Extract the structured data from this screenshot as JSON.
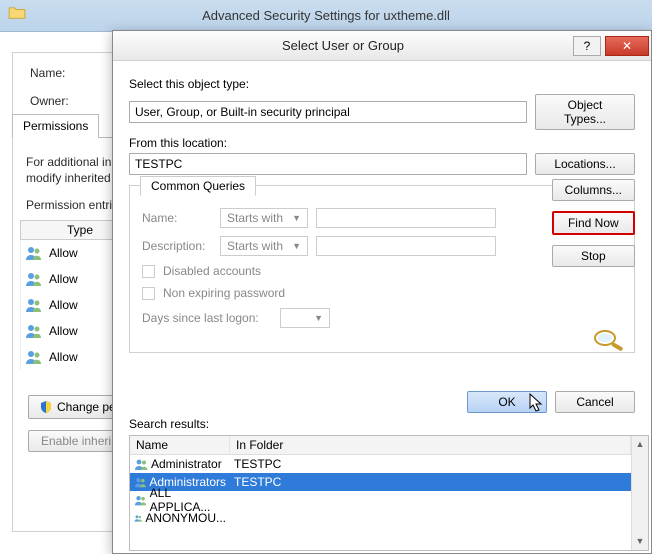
{
  "main_window": {
    "title": "Advanced Security Settings for uxtheme.dll",
    "name_label": "Name:",
    "owner_label": "Owner:",
    "tab_permissions": "Permissions",
    "info_line1": "For additional in",
    "info_line2": "modify inherited",
    "entries_label": "Permission entri",
    "type_header": "Type",
    "rows": [
      "Allow",
      "Allow",
      "Allow",
      "Allow",
      "Allow"
    ],
    "change_btn": "Change pe",
    "enable_btn": "Enable inheri"
  },
  "dialog": {
    "title": "Select User or Group",
    "object_type_label": "Select this object type:",
    "object_type_value": "User, Group, or Built-in security principal",
    "object_types_btn": "Object Types...",
    "location_label": "From this location:",
    "location_value": "TESTPC",
    "locations_btn": "Locations...",
    "common_queries_tab": "Common Queries",
    "name_label": "Name:",
    "desc_label": "Description:",
    "starts_with": "Starts with",
    "disabled_accounts": "Disabled accounts",
    "non_expiring": "Non expiring password",
    "days_since": "Days since last logon:",
    "columns_btn": "Columns...",
    "find_now_btn": "Find Now",
    "stop_btn": "Stop",
    "ok_btn": "OK",
    "cancel_btn": "Cancel",
    "search_results_label": "Search results:",
    "result_col_name": "Name",
    "result_col_folder": "In Folder",
    "results": [
      {
        "name": "Administrator",
        "folder": "TESTPC",
        "selected": false
      },
      {
        "name": "Administrators",
        "folder": "TESTPC",
        "selected": true
      },
      {
        "name": "ALL APPLICA...",
        "folder": "",
        "selected": false
      },
      {
        "name": "ANONYMOU...",
        "folder": "",
        "selected": false
      }
    ]
  }
}
